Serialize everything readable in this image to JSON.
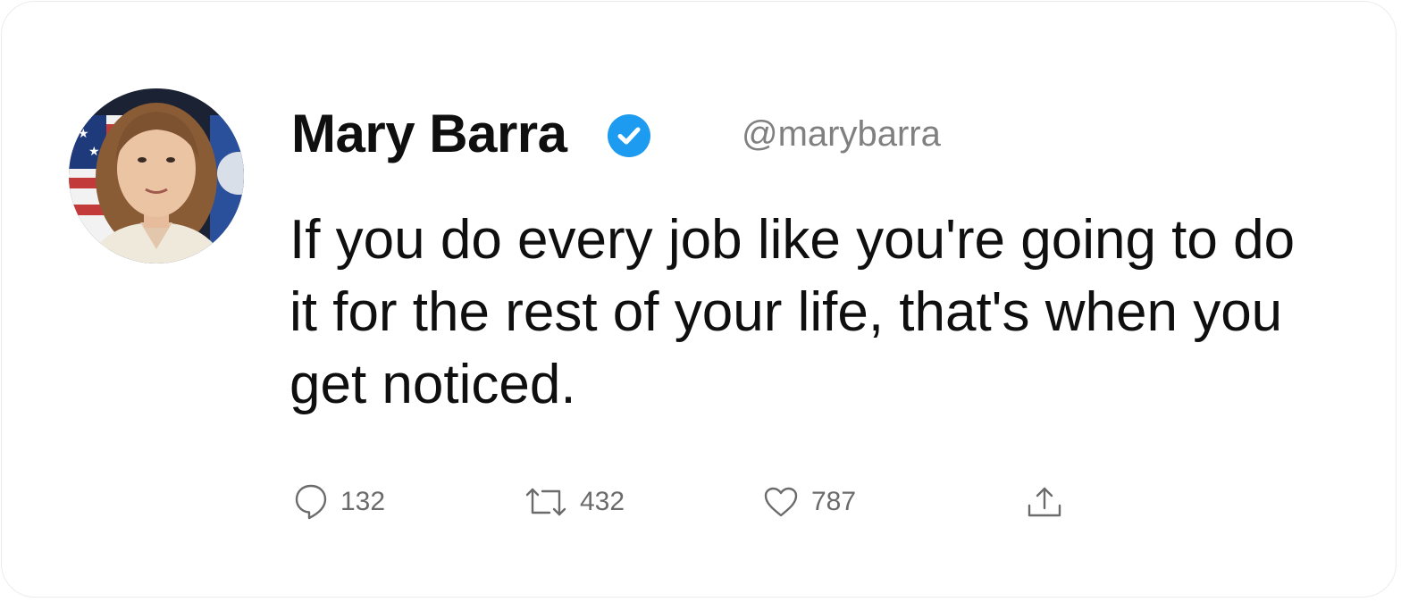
{
  "author": {
    "name": "Mary Barra",
    "handle": "@marybarra",
    "verified": true,
    "avatar_icon": "profile-photo"
  },
  "tweet": {
    "text": "If you do every job like you're going to do it for the rest of your life, that's when you get noticed."
  },
  "actions": {
    "reply": {
      "icon": "comment-icon",
      "count": "132"
    },
    "retweet": {
      "icon": "retweet-icon",
      "count": "432"
    },
    "like": {
      "icon": "heart-icon",
      "count": "787"
    },
    "share": {
      "icon": "share-icon"
    }
  },
  "colors": {
    "verified_badge": "#1d9bf0",
    "text_primary": "#0f0f0f",
    "text_secondary": "#808080",
    "action_gray": "#6b6b6b"
  }
}
